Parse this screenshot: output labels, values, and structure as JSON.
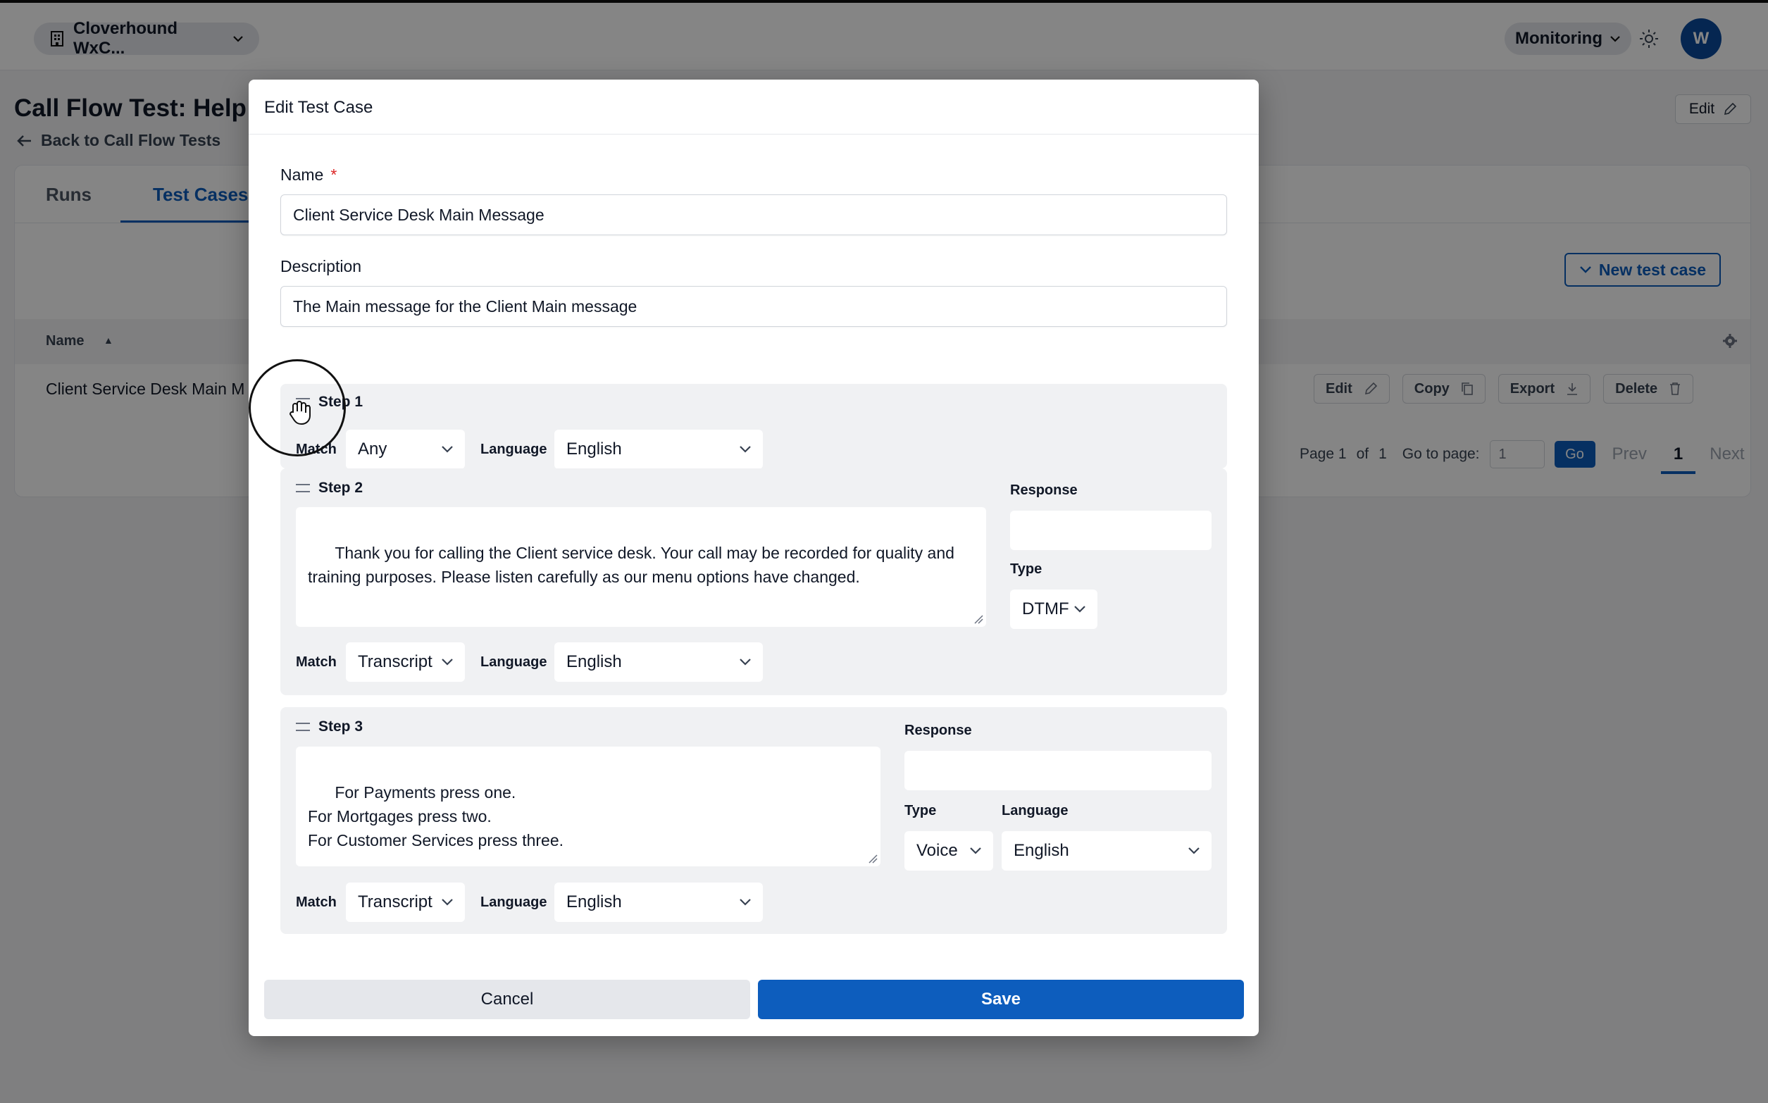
{
  "topbar": {
    "org_name": "Cloverhound WxC...",
    "monitoring_label": "Monitoring",
    "avatar_initial": "W"
  },
  "page": {
    "title": "Call Flow Test: Help I",
    "back_link": "Back to Call Flow Tests",
    "edit_label": "Edit"
  },
  "tabs": [
    {
      "label": "Runs"
    },
    {
      "label": "Test Cases"
    }
  ],
  "table": {
    "new_test_label": "New test case",
    "column_name": "Name",
    "row_name": "Client Service Desk Main M",
    "actions": {
      "edit": "Edit",
      "copy": "Copy",
      "export": "Export",
      "delete": "Delete"
    }
  },
  "pagination": {
    "page_label": "Page 1",
    "of_label": "of",
    "total": "1",
    "goto_label": "Go to page:",
    "goto_value": "1",
    "go_label": "Go",
    "prev_label": "Prev",
    "current": "1",
    "next_label": "Next"
  },
  "modal": {
    "title": "Edit Test Case",
    "name_label": "Name",
    "required_mark": "*",
    "name_value": "Client Service Desk Main Message",
    "description_label": "Description",
    "description_value": "The Main message for the Client Main message",
    "cancel_label": "Cancel",
    "save_label": "Save",
    "match_label": "Match",
    "language_label": "Language",
    "response_label": "Response",
    "type_label": "Type",
    "steps": [
      {
        "title": "Step 1",
        "match": "Any",
        "language": "English"
      },
      {
        "title": "Step 2",
        "text": "Thank you for calling the Client service desk. Your call may be recorded for quality and training purposes. Please listen carefully as our menu options have changed.",
        "response": "",
        "type": "DTMF",
        "match": "Transcript",
        "language": "English"
      },
      {
        "title": "Step 3",
        "text": "For Payments press one.\nFor Mortgages press two.\nFor Customer Services press three.",
        "response": "",
        "type": "Voice",
        "response_language": "English",
        "match": "Transcript",
        "language": "English"
      }
    ]
  },
  "colors": {
    "primary": "#0d5dbd",
    "required": "#dc2626",
    "step_bg": "#f0f1f3"
  }
}
